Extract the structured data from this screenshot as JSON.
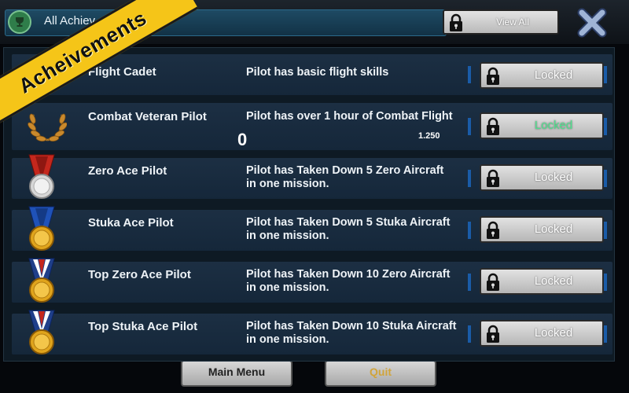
{
  "header": {
    "title": "All Achiev",
    "view_all_label": "View All"
  },
  "ribbon": {
    "text": "Acheivements"
  },
  "background_menu": {
    "main_menu_label": "Main Menu",
    "quit_label": "Quit"
  },
  "achievements": [
    {
      "name": "Flight Cadet",
      "description_line1": "Pilot has basic flight skills",
      "description_line2": "",
      "status": "Locked",
      "medal": "wings-icon"
    },
    {
      "name": "Combat Veteran Pilot",
      "description_line1": "Pilot has over 1 hour of Combat Flight",
      "description_line2": "",
      "status": "Locked",
      "medal": "laurel-wreath-icon",
      "progress_value": "0",
      "progress_target": "1.250"
    },
    {
      "name": "Zero Ace Pilot",
      "description_line1": "Pilot has Taken Down 5 Zero Aircraft",
      "description_line2": "in one mission.",
      "status": "Locked",
      "medal": "silver-medal-icon"
    },
    {
      "name": "Stuka Ace Pilot",
      "description_line1": "Pilot has Taken Down 5 Stuka Aircraft",
      "description_line2": "in one mission.",
      "status": "Locked",
      "medal": "gold-medal-icon"
    },
    {
      "name": "Top Zero Ace Pilot",
      "description_line1": "Pilot has Taken Down 10 Zero Aircraft",
      "description_line2": "in one mission.",
      "status": "Locked",
      "medal": "gold-medal-icon"
    },
    {
      "name": "Top Stuka Ace Pilot",
      "description_line1": "Pilot has Taken Down 10 Stuka Aircraft",
      "description_line2": "in one mission.",
      "status": "Locked",
      "medal": "gold-medal-icon"
    }
  ],
  "colors": {
    "ribbon": "#f5c518",
    "row_bg": "#1c2f43",
    "unlocked_text": "#4fe08d",
    "button_blue_tab": "#1a5ca8"
  }
}
